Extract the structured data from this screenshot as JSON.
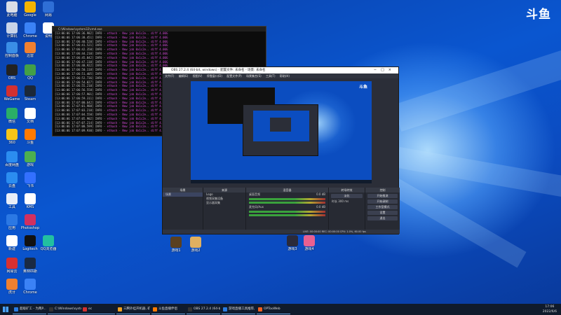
{
  "watermark": "斗鱼",
  "desktop_icons": [
    {
      "id": "i1",
      "label": "此电脑",
      "color": "#d8dde6"
    },
    {
      "id": "i2",
      "label": "Google",
      "color": "#f4b400"
    },
    {
      "id": "i3",
      "label": "网易",
      "color": "#2f6fd6"
    },
    {
      "id": "i4",
      "label": "计算机",
      "color": "#c8d4e8"
    },
    {
      "id": "i5",
      "label": "Chrome",
      "color": "#3b82f6"
    },
    {
      "id": "i6",
      "label": "说明",
      "color": "#ffffff"
    },
    {
      "id": "i7",
      "label": "控制面板",
      "color": "#3a8ee6"
    },
    {
      "id": "i8",
      "label": "迅雷",
      "color": "#f08030"
    },
    {
      "id": "i9",
      "label": "OBS",
      "color": "#222222"
    },
    {
      "id": "i10",
      "label": "QQ",
      "color": "#43a047"
    },
    {
      "id": "i11",
      "label": "WeGame",
      "color": "#d23030"
    },
    {
      "id": "i12",
      "label": "Steam",
      "color": "#1b2838"
    },
    {
      "id": "i13",
      "label": "微信",
      "color": "#2aae67"
    },
    {
      "id": "i14",
      "label": "文档",
      "color": "#ffffff"
    },
    {
      "id": "i15",
      "label": "360",
      "color": "#f5c518"
    },
    {
      "id": "i16",
      "label": "斗鱼",
      "color": "#ff7a00"
    },
    {
      "id": "i17",
      "label": "百度网盘",
      "color": "#2b8df0"
    },
    {
      "id": "i18",
      "label": "游戏",
      "color": "#4caf50"
    },
    {
      "id": "i19",
      "label": "云盘",
      "color": "#2b8df0"
    },
    {
      "id": "i20",
      "label": "飞书",
      "color": "#3370ff"
    },
    {
      "id": "i21",
      "label": "工具",
      "color": "#e8eef8"
    },
    {
      "id": "i22",
      "label": "KMS",
      "color": "#ffffff"
    },
    {
      "id": "i23",
      "label": "应用",
      "color": "#2b78e4"
    },
    {
      "id": "i24",
      "label": "Photoshop",
      "color": "#d03060"
    },
    {
      "id": "i25",
      "label": "新建",
      "color": "#ffffff"
    },
    {
      "id": "i26",
      "label": "Logitech",
      "color": "#111111"
    },
    {
      "id": "i27",
      "label": "QQ浏览器",
      "color": "#22c0a0"
    },
    {
      "id": "i28",
      "label": "网易云",
      "color": "#d83030"
    },
    {
      "id": "i29",
      "label": "奥林匹斯",
      "color": "#1a2a44"
    },
    {
      "id": "i30",
      "label": "虎牙",
      "color": "#f08030"
    },
    {
      "id": "i31",
      "label": "Chrome",
      "color": "#3b82f6"
    },
    {
      "id": "i32",
      "label": "游戏1",
      "color": "#5a4020"
    },
    {
      "id": "i33",
      "label": "游戏2",
      "color": "#e0b060"
    },
    {
      "id": "i34",
      "label": "游戏3",
      "color": "#2a2a3a"
    },
    {
      "id": "i35",
      "label": "游戏4",
      "color": "#e86090"
    }
  ],
  "cmd_window": {
    "title": "C:\\Windows\\system32\\cmd.exe",
    "lines": [
      "[13:06:06 17:06:36.982] INFO - ",
      "[13:06:06 17:06:38.451] INFO - ",
      "[13:06:06 17:06:40.520] INFO - ",
      "[13:06:06 17:06:41.521] INFO - ",
      "[13:06:06 17:06:42.350] INFO - ",
      "[13:06:06 17:06:44.210] INFO - ",
      "[13:06:06 17:06:45.842] INFO - ",
      "[13:06:06 17:06:47.110] INFO - ",
      "[13:06:06 17:06:48.922] INFO - ",
      "[13:06:06 17:06:50.118] INFO - ",
      "[13:06:06 17:06:51.405] INFO - ",
      "[13:06:06 17:06:52.736] INFO - ",
      "[13:06:06 17:06:54.027] INFO - ",
      "[13:06:06 17:06:55.210] INFO - ",
      "[13:06:06 17:06:56.558] INFO - ",
      "[13:06:06 17:06:57.901] INFO - ",
      "[13:06:06 17:06:59.311] INFO - ",
      "[13:06:06 17:07:00.642] INFO - ",
      "[13:06:06 17:07:01.988] INFO - ",
      "[13:06:06 17:07:03.210] INFO - ",
      "[13:06:06 17:07:04.550] INFO - ",
      "[13:06:06 17:07:05.902] INFO - ",
      "[13:06:06 17:07:07.214] INFO - ",
      "[13:06:06 17:07:08.599] INFO - ",
      "[13:06:06 17:07:09.930] INFO - "
    ],
    "magenta": "ethash - New job  0x1c2e..  diff 4.00G"
  },
  "obs": {
    "title": "OBS 27.2.4 (64-bit, windows) - 配置文件: 未命名 - 场景: 未命名",
    "menu": "文件(F) 编辑(E) 视图(V) 停靠窗口(D) 配置文件(P) 场景集合(S) 工具(T) 帮助(H)",
    "panels": {
      "scenes": "场景",
      "sources": "来源",
      "mixer": "混音器",
      "transitions": "转场特效",
      "controls": "控制"
    },
    "scene_item": "场景",
    "sources": [
      "Logo",
      "视频采集设备",
      "显示器采集"
    ],
    "mixer": [
      {
        "name": "桌面音频",
        "db": "0.0 dB"
      },
      {
        "name": "麦克风/Aux",
        "db": "0.0 dB"
      }
    ],
    "transition": {
      "type": "淡化",
      "duration_label": "时长",
      "duration": "300 ms"
    },
    "controls": [
      "开始推流",
      "开始录制",
      "工作室模式",
      "设置",
      "退出"
    ],
    "status": "LIVE: 00:00:00   REC: 00:00:00   CPU: 1.0%, 60.00 fps"
  },
  "taskbar": {
    "items": [
      {
        "label": "超级矿工 - 为两P...",
        "color": "#2a7be0"
      },
      {
        "label": "C:\\Windows\\syste...",
        "color": "#333333"
      },
      {
        "label": "ec",
        "color": "#d23030"
      },
      {
        "label": "三腾外挂开机器, 矿...",
        "color": "#f0a020"
      },
      {
        "label": "斗鱼直播伴侣",
        "color": "#ff7a00"
      },
      {
        "label": "OBS 27.2.4 (64-bit...",
        "color": "#333333"
      },
      {
        "label": "游戏直播工具推荐, 兑...",
        "color": "#2a7be0"
      },
      {
        "label": "OPTooWeb",
        "color": "#f06020"
      }
    ],
    "time": "17:06",
    "date": "2022/6/6"
  }
}
